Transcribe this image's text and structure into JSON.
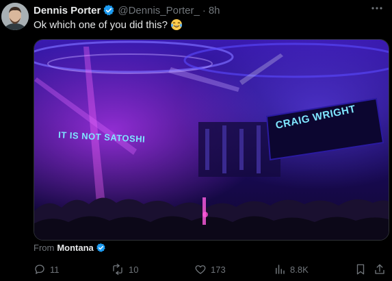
{
  "post": {
    "author_name": "Dennis Porter",
    "handle": "@Dennis_Porter_",
    "separator": "·",
    "time": "8h",
    "text": "Ok which one of you did this?",
    "emoji": "laughing-crying-emoji"
  },
  "media": {
    "left_banner": "IT IS NOT SATOSHI",
    "right_banner": "CRAIG WRIGHT"
  },
  "attribution": {
    "prefix": "From",
    "source": "Montana"
  },
  "actions": {
    "replies": "11",
    "reposts": "10",
    "likes": "173",
    "views": "8.8K"
  },
  "colors": {
    "verified": "#1d9bf0",
    "muted": "#71767b",
    "text": "#e7e9ea"
  }
}
